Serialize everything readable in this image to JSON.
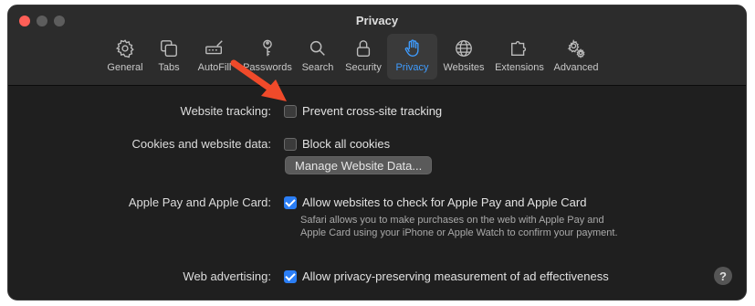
{
  "window": {
    "title": "Privacy"
  },
  "toolbar": {
    "tabs": [
      {
        "label": "General",
        "icon": "gear-icon",
        "active": false
      },
      {
        "label": "Tabs",
        "icon": "tabs-icon",
        "active": false
      },
      {
        "label": "AutoFill",
        "icon": "autofill-icon",
        "active": false
      },
      {
        "label": "Passwords",
        "icon": "key-icon",
        "active": false
      },
      {
        "label": "Search",
        "icon": "search-icon",
        "active": false
      },
      {
        "label": "Security",
        "icon": "lock-icon",
        "active": false
      },
      {
        "label": "Privacy",
        "icon": "hand-icon",
        "active": true
      },
      {
        "label": "Websites",
        "icon": "globe-icon",
        "active": false
      },
      {
        "label": "Extensions",
        "icon": "puzzle-icon",
        "active": false
      },
      {
        "label": "Advanced",
        "icon": "gears-icon",
        "active": false
      }
    ]
  },
  "settings": {
    "tracking": {
      "label": "Website tracking:",
      "option": "Prevent cross-site tracking",
      "checked": false
    },
    "cookies": {
      "label": "Cookies and website data:",
      "option": "Block all cookies",
      "checked": false,
      "button": "Manage Website Data..."
    },
    "applepay": {
      "label": "Apple Pay and Apple Card:",
      "option": "Allow websites to check for Apple Pay and Apple Card",
      "checked": true,
      "description": "Safari allows you to make purchases on the web with Apple Pay and Apple Card using your iPhone or Apple Watch to confirm your payment."
    },
    "advertising": {
      "label": "Web advertising:",
      "option": "Allow privacy-preserving measurement of ad effectiveness",
      "checked": true
    }
  },
  "help": {
    "label": "?"
  },
  "colors": {
    "accent": "#3f9cff",
    "checkbox_checked": "#2b7ef5",
    "arrow": "#f04a2a",
    "close": "#ff5f57"
  }
}
